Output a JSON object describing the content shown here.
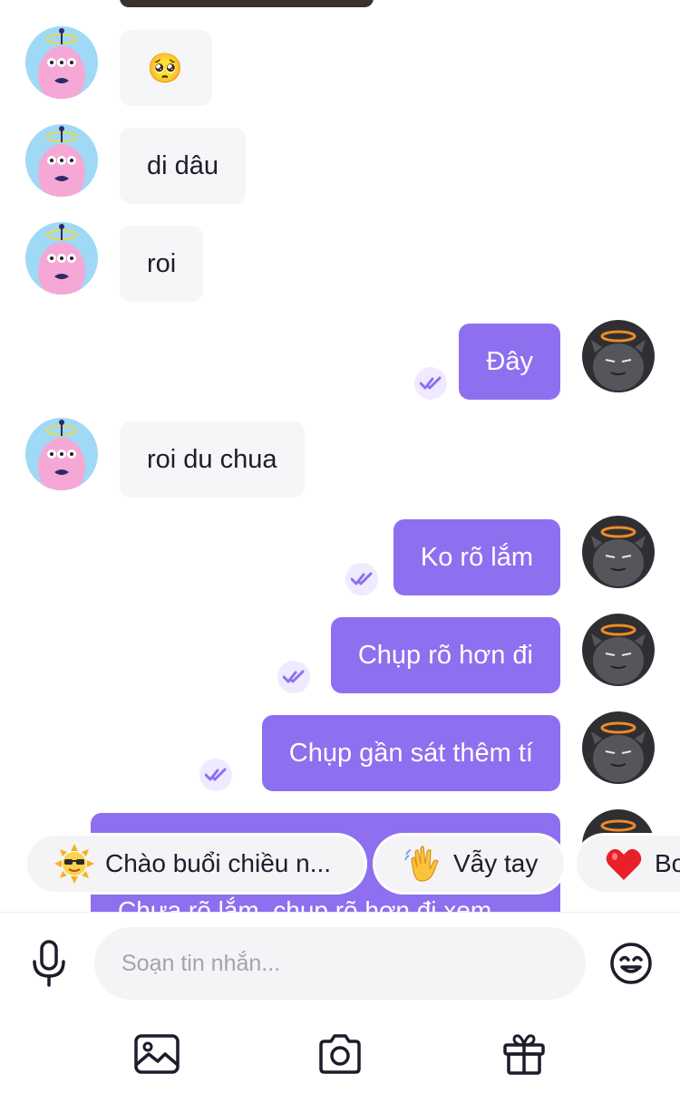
{
  "messages": {
    "m1_emoji": "🥺",
    "m2": "di dâu",
    "m3": "roi",
    "m4": "Đây",
    "m5": "roi du chua",
    "m6": "Ko rõ lắm",
    "m7": "Chụp rõ hơn đi",
    "m8": "Chụp gần sát thêm tí",
    "m9_partial": "Chưa rõ lắm, chụp rõ hơn đi xem"
  },
  "quick_replies": [
    {
      "label": "Chào buổi chiều n...",
      "icon": "sun-sunglasses-icon"
    },
    {
      "label": "Vẫy tay",
      "icon": "waving-hand-icon"
    },
    {
      "label": "Bo",
      "icon": "red-heart-icon"
    }
  ],
  "composer": {
    "placeholder": "Soạn tin nhắn..."
  },
  "colors": {
    "outgoing_bubble": "#8d6ff0",
    "incoming_bubble": "#f6f6f9",
    "read_tick": "#8d6ff0"
  }
}
